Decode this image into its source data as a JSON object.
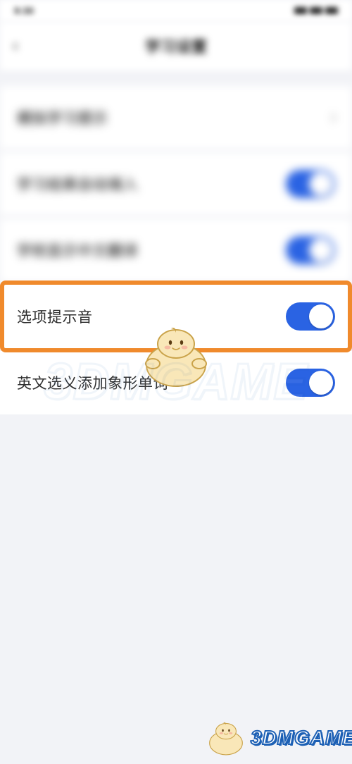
{
  "status": {
    "time": "9:30"
  },
  "nav": {
    "title": "学习设置"
  },
  "rows": {
    "r0": {
      "label": "模拟学习提示"
    },
    "r1": {
      "label": "学习结果自动填入"
    },
    "r2": {
      "label": "学校显示中文翻译"
    },
    "r3": {
      "label": "选项提示音"
    },
    "r4": {
      "label": "英文选义添加象形单词"
    }
  },
  "watermark": "3DMGAME"
}
